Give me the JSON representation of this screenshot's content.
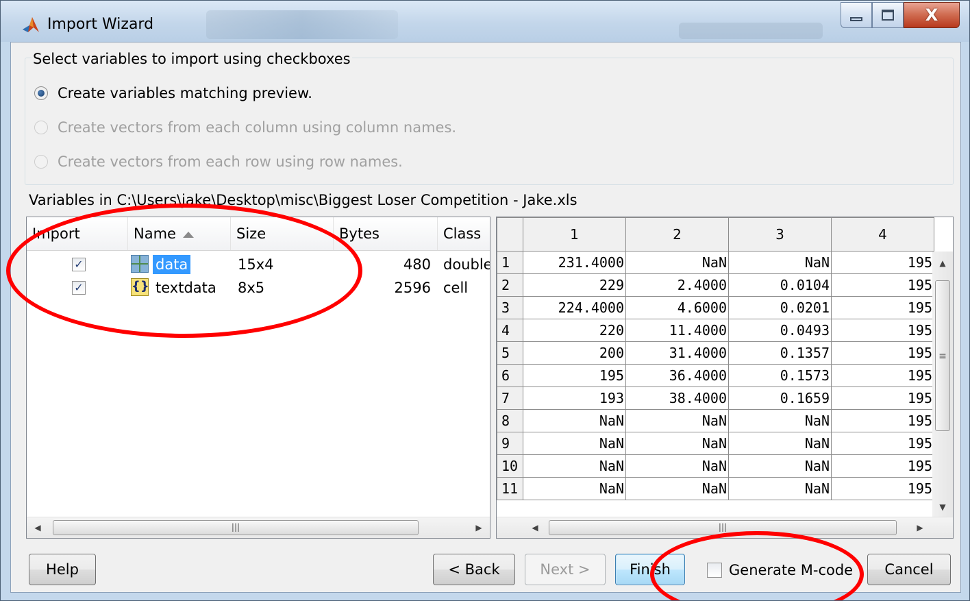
{
  "window": {
    "title": "Import Wizard",
    "close_glyph": "X"
  },
  "options": {
    "group_label": "Select variables to import using checkboxes",
    "radio_preview": "Create variables matching preview.",
    "radio_columns": "Create vectors from each column using column names.",
    "radio_rows": "Create vectors from each row using row names.",
    "selected": "radio_preview"
  },
  "variables": {
    "path_label": "Variables in C:\\Users\\jake\\Desktop\\misc\\Biggest Loser Competition - Jake.xls",
    "columns": [
      "Import",
      "Name",
      "Size",
      "Bytes",
      "Class"
    ],
    "rows": [
      {
        "checked": true,
        "icon": "matrix-icon",
        "name": "data",
        "size": "15x4",
        "bytes": "480",
        "class": "double"
      },
      {
        "checked": true,
        "icon": "cell-array-icon",
        "name": "textdata",
        "size": "8x5",
        "bytes": "2596",
        "class": "cell"
      }
    ]
  },
  "preview": {
    "col_headers": [
      "1",
      "2",
      "3",
      "4"
    ],
    "rows": [
      {
        "row": "1",
        "cells": [
          "231.4000",
          "NaN",
          "NaN",
          "195"
        ]
      },
      {
        "row": "2",
        "cells": [
          "229",
          "2.4000",
          "0.0104",
          "195"
        ]
      },
      {
        "row": "3",
        "cells": [
          "224.4000",
          "4.6000",
          "0.0201",
          "195"
        ]
      },
      {
        "row": "4",
        "cells": [
          "220",
          "11.4000",
          "0.0493",
          "195"
        ]
      },
      {
        "row": "5",
        "cells": [
          "200",
          "31.4000",
          "0.1357",
          "195"
        ]
      },
      {
        "row": "6",
        "cells": [
          "195",
          "36.4000",
          "0.1573",
          "195"
        ]
      },
      {
        "row": "7",
        "cells": [
          "193",
          "38.4000",
          "0.1659",
          "195"
        ]
      },
      {
        "row": "8",
        "cells": [
          "NaN",
          "NaN",
          "NaN",
          "195"
        ]
      },
      {
        "row": "9",
        "cells": [
          "NaN",
          "NaN",
          "NaN",
          "195"
        ]
      },
      {
        "row": "10",
        "cells": [
          "NaN",
          "NaN",
          "NaN",
          "195"
        ]
      },
      {
        "row": "11",
        "cells": [
          "NaN",
          "NaN",
          "NaN",
          "195"
        ]
      }
    ]
  },
  "buttons": {
    "help": "Help",
    "back": "< Back",
    "next": "Next >",
    "finish": "Finish",
    "generate_mcode": "Generate M-code",
    "generate_mcode_checked": false,
    "cancel": "Cancel"
  },
  "colors": {
    "annotation": "#ff0000",
    "selection": "#3399ff"
  }
}
